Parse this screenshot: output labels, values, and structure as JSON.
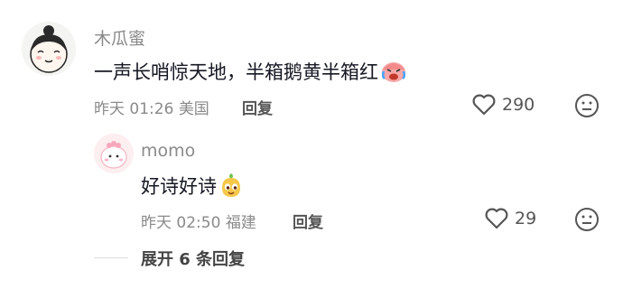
{
  "comment": {
    "username": "木瓜蜜",
    "text": "一声长哨惊天地，半箱鹅黄半箱红",
    "emoji_icon": "crying-laughing-face-icon",
    "time": "昨天 01:26",
    "location": "美国",
    "reply_label": "回复",
    "likes": "290"
  },
  "reply": {
    "username": "momo",
    "text": "好诗好诗",
    "emoji_icon": "cheeky-bun-face-icon",
    "time": "昨天 02:50",
    "location": "福建",
    "reply_label": "回复",
    "likes": "29"
  },
  "expand_label": "展开 6 条回复",
  "colors": {
    "muted_text": "#8a8a8a",
    "main_text": "#161823",
    "icon_gray": "#555555"
  }
}
